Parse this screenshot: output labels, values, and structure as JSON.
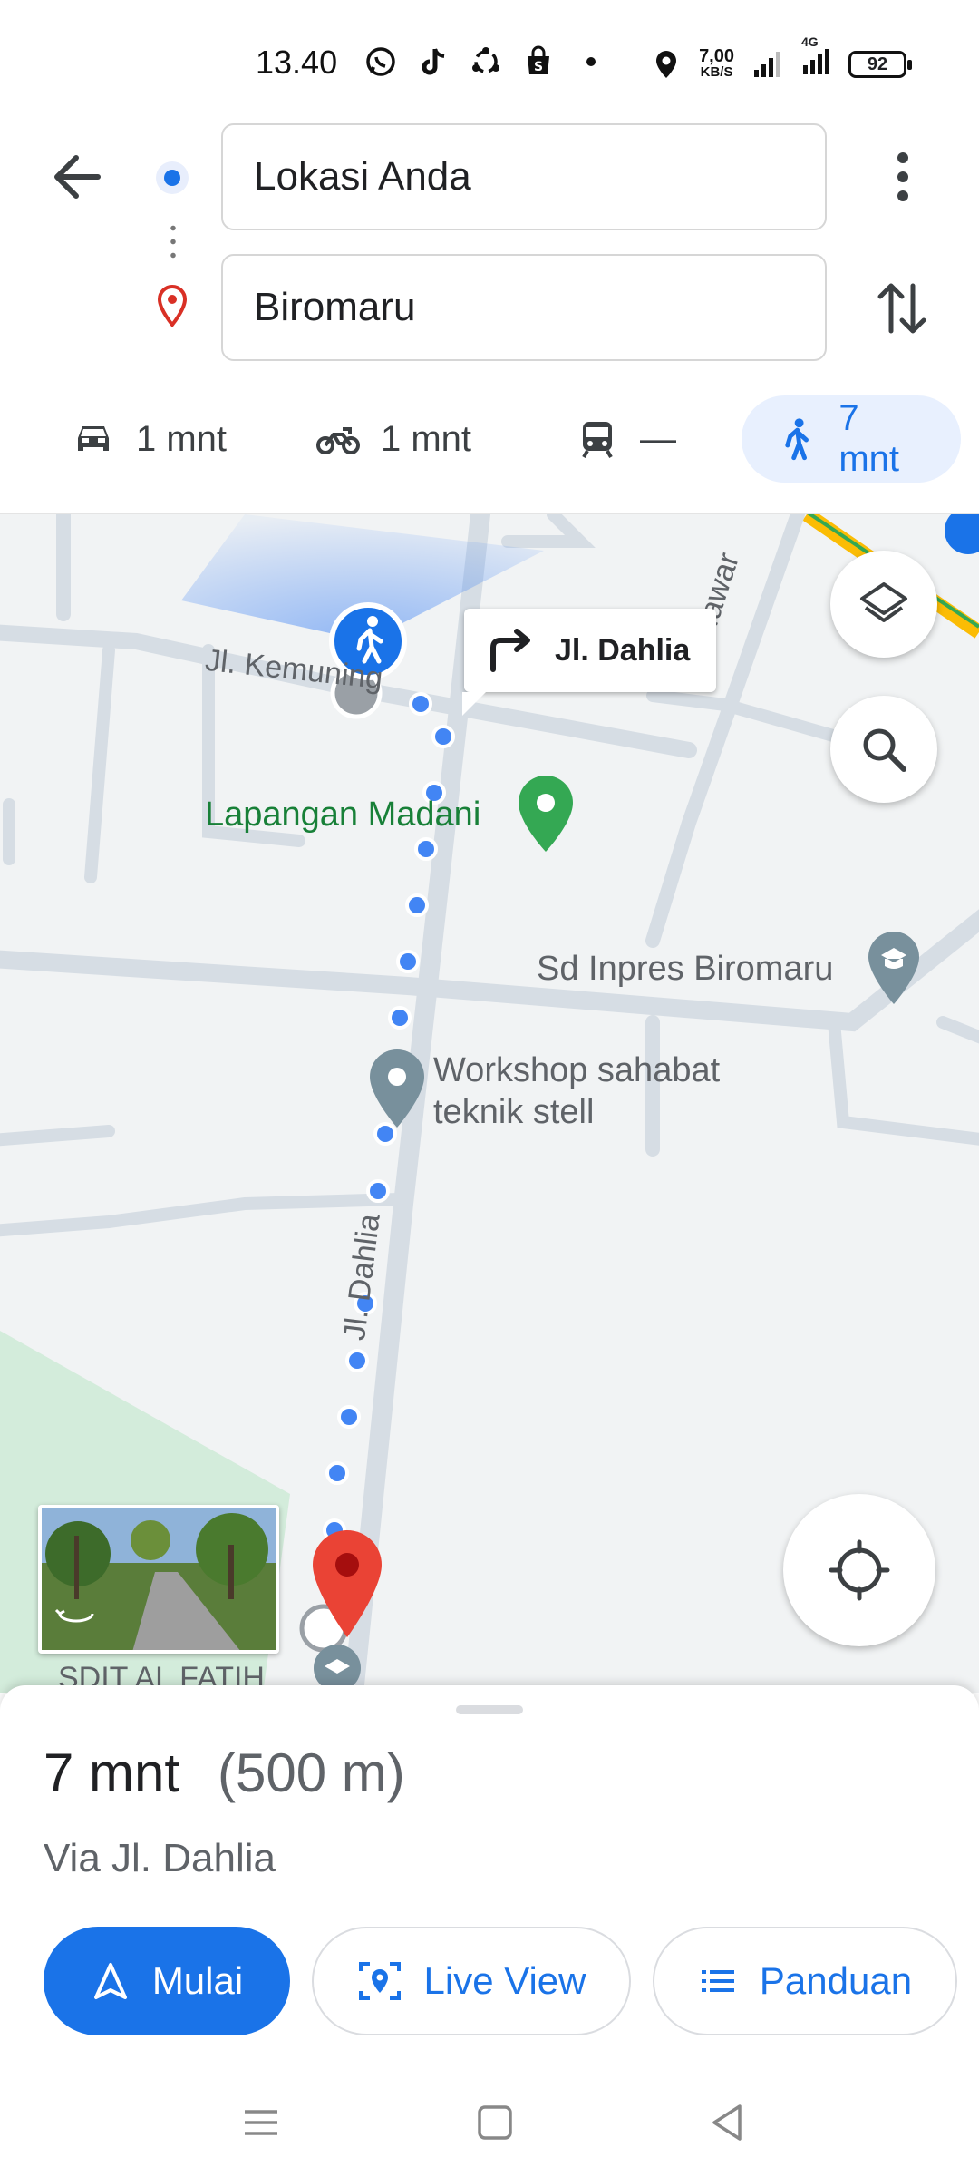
{
  "status_bar": {
    "time": "13.40",
    "net_speed_value": "7,00",
    "net_speed_unit": "KB/S",
    "network_type": "4G",
    "battery": "92",
    "icons": [
      "whatsapp-icon",
      "tiktok-icon",
      "sync-icon",
      "shop-icon",
      "dot-icon",
      "location-icon",
      "signal-icon",
      "signal-4g-icon",
      "battery-icon"
    ]
  },
  "search": {
    "origin": "Lokasi Anda",
    "destination": "Biromaru"
  },
  "travel_modes": [
    {
      "mode": "car",
      "label": "1 mnt",
      "active": false
    },
    {
      "mode": "motorcycle",
      "label": "1 mnt",
      "active": false
    },
    {
      "mode": "transit",
      "label": "—",
      "active": false
    },
    {
      "mode": "walk",
      "label": "7 mnt",
      "active": true
    }
  ],
  "map": {
    "turn_instruction": "Jl. Dahlia",
    "labels": {
      "road_kemuning": "Jl. Kemuning",
      "road_mawar": "Jl. Mawar",
      "road_dahlia": "Jl. Dahlia",
      "park": "Lapangan Madani",
      "school": "Sd Inpres Biromaru",
      "workshop_line1": "Workshop sahabat",
      "workshop_line2": "teknik stell",
      "school_bottom": "SDIT AL FATIH"
    },
    "colors": {
      "route": "#4285f4",
      "destination_pin": "#ea4335",
      "park_pin": "#34a853",
      "poi_pin": "#78909c"
    }
  },
  "route_summary": {
    "duration": "7 mnt",
    "distance": "(500 m)",
    "via": "Via Jl. Dahlia"
  },
  "actions": {
    "start": "Mulai",
    "live_view": "Live View",
    "steps": "Panduan"
  },
  "colors": {
    "accent": "#1a73e8",
    "active_mode_bg": "#e8f0fe"
  }
}
